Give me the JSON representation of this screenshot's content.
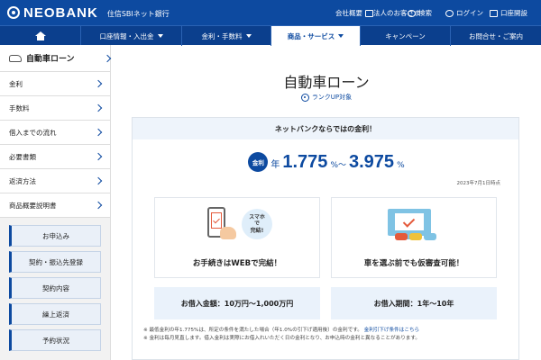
{
  "header": {
    "logo_text": "NEOBANK",
    "logo_sub": "住信SBIネット銀行",
    "util_links": [
      {
        "label": "会社概要",
        "icon": "building-icon"
      },
      {
        "label": "法人のお客さま",
        "icon": "briefcase-icon"
      },
      {
        "label": "検索",
        "icon": "search-icon"
      },
      {
        "label": "ログイン",
        "icon": "user-icon"
      },
      {
        "label": "口座開設",
        "icon": "card-icon"
      }
    ]
  },
  "nav": {
    "items": [
      {
        "label": "口座情報・入出金",
        "caret": true
      },
      {
        "label": "金利・手数料",
        "caret": true
      },
      {
        "label": "商品・サービス",
        "caret": true
      },
      {
        "label": "キャンペーン",
        "caret": false
      },
      {
        "label": "お問合せ・ご案内",
        "caret": false
      }
    ]
  },
  "sidebar": {
    "title": "自動車ローン",
    "items": [
      "金利",
      "手数料",
      "借入までの流れ",
      "必要書類",
      "返済方法",
      "商品概要説明書"
    ],
    "buttons": [
      "お申込み",
      "契約・振込先登録",
      "契約内容",
      "繰上返済",
      "予約状況"
    ]
  },
  "main": {
    "title": "自動車ローン",
    "rankup": "ランクUP対象",
    "card_head": "ネットバンクならではの金利！",
    "rate_badge": "金利",
    "rate_prefix": "年",
    "rate_low": "1.775",
    "rate_mid_unit": "%〜",
    "rate_high": "3.975",
    "rate_end_unit": "%",
    "rate_date": "2023年7月1日時点",
    "features": [
      {
        "text": "お手続きはWEBで完結！",
        "bubble": "スマホ\nで\n完結!"
      },
      {
        "text": "車を選ぶ前でも仮審査可能！"
      }
    ],
    "info": [
      "お借入金額：10万円〜1,000万円",
      "お借入期間：1年〜10年"
    ],
    "notes": [
      "※ 最低金利の年1.775%は、所定の条件を満たした場合（年1.0%の引下げ適用後）の金利です。",
      "金利引下げ条件はこちら",
      "※ 金利は毎月見直します。借入金利は実際にお借入れいただく日の金利となり、お申込時の金利と異なることがあります。"
    ]
  },
  "colors": {
    "brand": "#0d4aa0",
    "accent": "#e45a3b"
  }
}
